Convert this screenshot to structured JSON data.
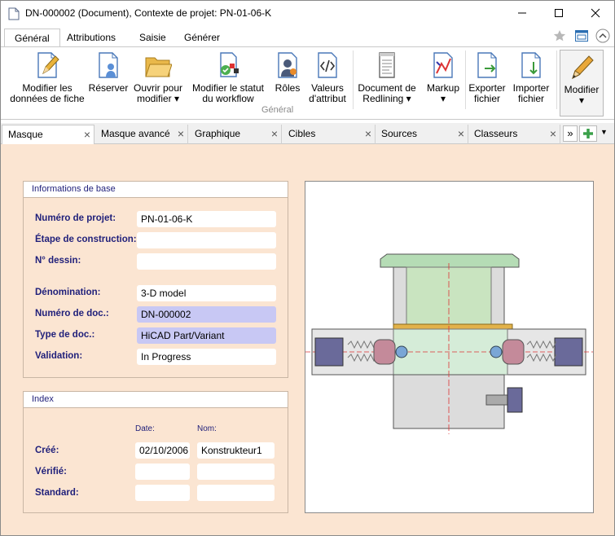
{
  "window": {
    "title": "DN-000002 (Document), Contexte de projet: PN-01-06-K"
  },
  "ribbon_tabs": [
    {
      "label": "Général"
    },
    {
      "label": "Attributions"
    },
    {
      "label": "Saisie"
    },
    {
      "label": "Générer"
    }
  ],
  "ribbon": {
    "group_label": "Général",
    "buttons": {
      "modify_data": {
        "line1": "Modifier les",
        "line2": "données de fiche"
      },
      "reserve": {
        "line1": "Réserver",
        "line2": ""
      },
      "open_modify": {
        "line1": "Ouvrir pour",
        "line2": "modifier ▾"
      },
      "modify_status": {
        "line1": "Modifier le statut",
        "line2": "du workflow"
      },
      "roles": {
        "line1": "Rôles",
        "line2": ""
      },
      "attr_values": {
        "line1": "Valeurs",
        "line2": "d'attribut"
      },
      "redlining": {
        "line1": "Document de",
        "line2": "Redlining ▾"
      },
      "markup": {
        "line1": "Markup",
        "line2": "▾"
      },
      "export": {
        "line1": "Exporter",
        "line2": "fichier"
      },
      "import": {
        "line1": "Importer",
        "line2": "fichier"
      },
      "modify": {
        "line1": "Modifier",
        "line2": "▾"
      }
    }
  },
  "doc_tabs": [
    {
      "label": "Masque"
    },
    {
      "label": "Masque avancé"
    },
    {
      "label": "Graphique"
    },
    {
      "label": "Cibles"
    },
    {
      "label": "Sources"
    },
    {
      "label": "Classeurs"
    }
  ],
  "doc_tabs_more": "»",
  "base_info": {
    "title": "Informations de base",
    "fields": [
      {
        "label": "Numéro de projet:",
        "value": "PN-01-06-K"
      },
      {
        "label": "Étape de construction:",
        "value": ""
      },
      {
        "label": "N° dessin:",
        "value": ""
      },
      {
        "label": "Dénomination:",
        "value": "3-D model"
      },
      {
        "label": "Numéro de doc.:",
        "value": "DN-000002"
      },
      {
        "label": "Type de doc.:",
        "value": "HiCAD Part/Variant"
      },
      {
        "label": "Validation:",
        "value": "In Progress"
      }
    ]
  },
  "index": {
    "title": "Index",
    "col_date": "Date:",
    "col_name": "Nom:",
    "rows": [
      {
        "label": "Créé:",
        "date": "02/10/2006",
        "name": "Konstrukteur1"
      },
      {
        "label": "Vérifié:",
        "date": "",
        "name": ""
      },
      {
        "label": "Standard:",
        "date": "",
        "name": ""
      }
    ]
  },
  "colors": {
    "panel_bg": "#fbe5d2",
    "label_text": "#1f1f7a",
    "highlight_field": "#c8c8f4"
  }
}
